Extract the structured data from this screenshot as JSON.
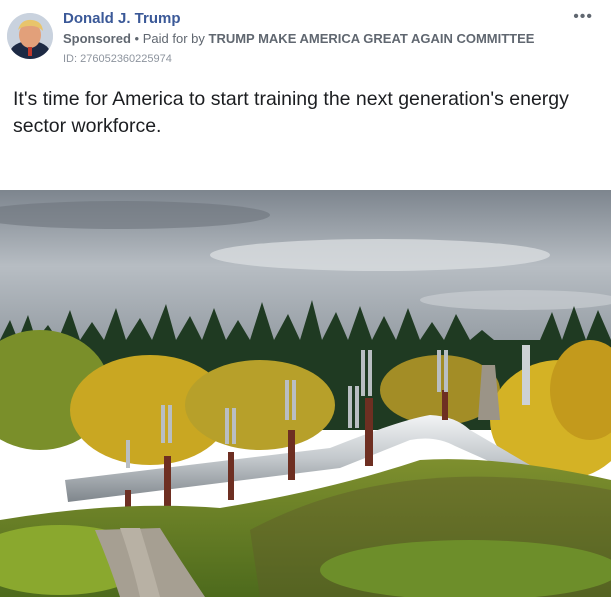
{
  "post": {
    "author": "Donald J. Trump",
    "sponsored_label": "Sponsored",
    "separator": "•",
    "paid_for_prefix": "Paid for by",
    "paid_for_entity": "TRUMP MAKE AMERICA GREAT AGAIN COMMITTEE",
    "ad_id": "ID: 276052360225974",
    "more_icon": "ellipsis-icon",
    "more_glyph": "•••",
    "text": "It's time for America to start training the next generation's energy sector workforce."
  },
  "media": {
    "subject": "Pipeline through autumn forest",
    "sky_color": "#9fa6ae",
    "forest_color": "#1f3a22",
    "foliage_color": "#d4b225",
    "pipe_color": "#c7ccd0",
    "grass_color": "#6d8e2a"
  }
}
